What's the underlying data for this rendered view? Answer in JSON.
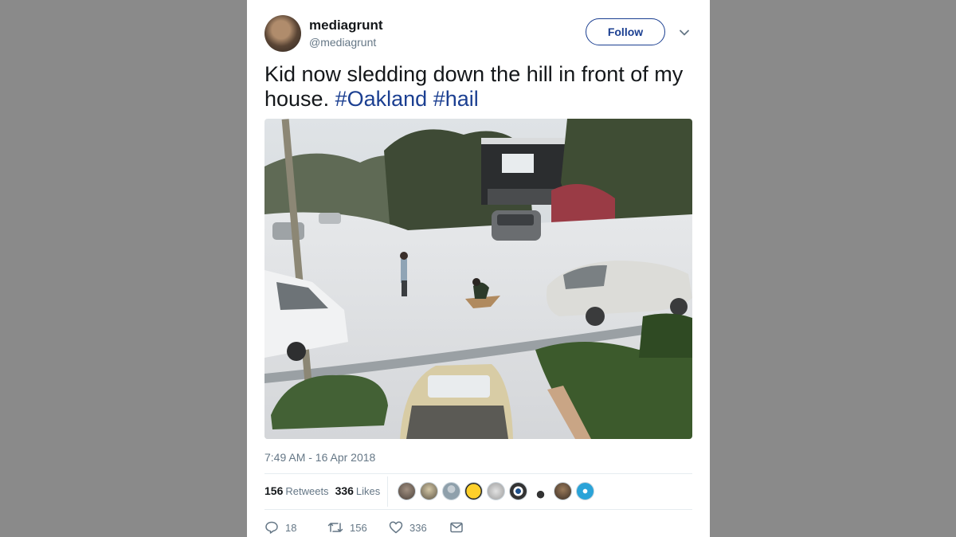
{
  "tweet": {
    "author_name": "mediagrunt",
    "author_handle": "@mediagrunt",
    "follow_label": "Follow",
    "text_plain": "Kid now sledding down the hill in front of my house.",
    "hashtags": [
      "#Oakland",
      "#hail"
    ],
    "timestamp": "7:49 AM - 16 Apr 2018"
  },
  "stats": {
    "retweets_count": "156",
    "retweets_label": "Retweets",
    "likes_count": "336",
    "likes_label": "Likes",
    "liker_avatar_count": 9
  },
  "actions": {
    "reply_count": "18",
    "retweet_count": "156",
    "like_count": "336"
  },
  "icons": {
    "caret": "chevron-down-icon",
    "reply": "reply-icon",
    "retweet": "retweet-icon",
    "like": "heart-icon",
    "dm": "envelope-icon"
  },
  "colors": {
    "link": "#1b3f91",
    "text": "#14171a",
    "muted": "#657786",
    "backdrop": "#8a8a8a"
  }
}
